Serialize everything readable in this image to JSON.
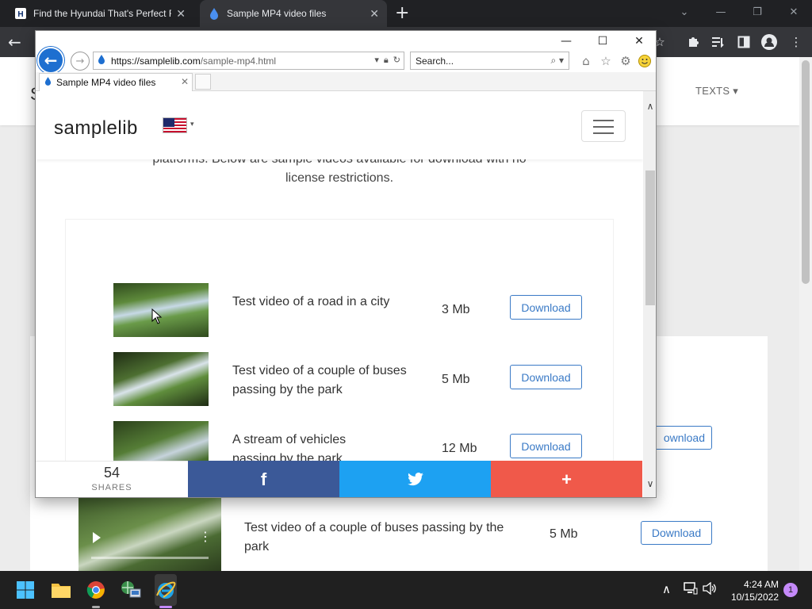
{
  "chrome": {
    "tabs": [
      {
        "title": "Find the Hyundai That's Perfect F",
        "close": "✕"
      },
      {
        "title": "Sample MP4 video files",
        "close": "✕"
      }
    ],
    "new_tab": "+",
    "window_controls": {
      "minimize": "—",
      "restore": "❐",
      "close": "✕"
    },
    "back": "←"
  },
  "background_page": {
    "logo_fragment": "S",
    "nav_texts": "TEXTS ▾",
    "download_label_partial": "ownload",
    "row": {
      "title": "Test video of a couple of buses passing by the park",
      "size": "5 Mb",
      "download": "Download"
    }
  },
  "ie": {
    "window_controls": {
      "minimize": "—",
      "maximize": "☐",
      "close": "✕"
    },
    "address": {
      "host": "https://samplelib.com",
      "path": "/sample-mp4.html"
    },
    "search_placeholder": "Search...",
    "tab_title": "Sample MP4 video files",
    "site": {
      "logo": "samplelib",
      "intro_line1": "platforms. Below are sample videos available for download with no",
      "intro_line2": "license restrictions.",
      "videos": [
        {
          "title": "Test video of a road in a city",
          "size": "3 Mb",
          "download": "Download"
        },
        {
          "title": "Test video of a couple of buses passing by the park",
          "size": "5 Mb",
          "download": "Download"
        },
        {
          "title": "A stream of vehicles passing by the park",
          "size": "12 Mb",
          "download": "Download"
        }
      ]
    },
    "share": {
      "count": "54",
      "count_label": "SHARES",
      "facebook": "f",
      "more": "+"
    }
  },
  "taskbar": {
    "time": "4:24 AM",
    "date": "10/15/2022",
    "notifications": "1"
  }
}
